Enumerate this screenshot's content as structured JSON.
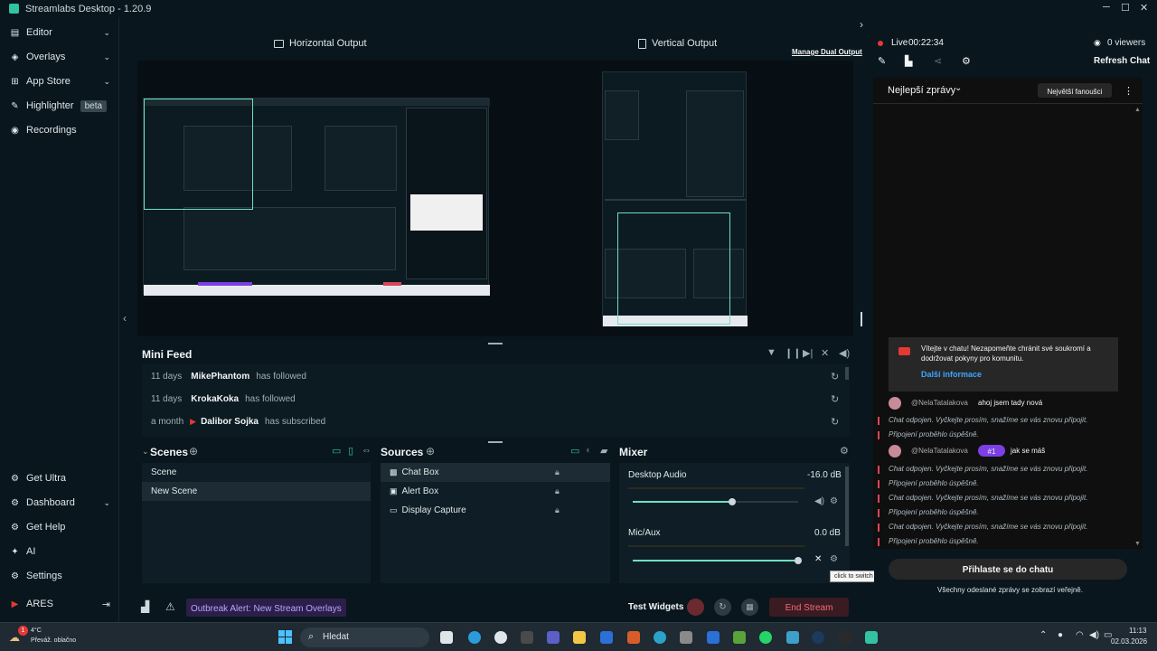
{
  "titlebar": {
    "title": "Streamlabs Desktop - 1.20.9"
  },
  "sidebar": {
    "items": [
      {
        "label": "Editor",
        "icon": "editor-icon"
      },
      {
        "label": "Overlays",
        "icon": "overlays-icon"
      },
      {
        "label": "App Store",
        "icon": "store-icon"
      },
      {
        "label": "Highlighter",
        "icon": "highlighter-icon",
        "badge": "beta"
      },
      {
        "label": "Recordings",
        "icon": "recordings-icon"
      }
    ],
    "bottom": [
      {
        "label": "Get Ultra",
        "icon": "ultra-icon"
      },
      {
        "label": "Dashboard",
        "icon": "dashboard-icon"
      },
      {
        "label": "Get Help",
        "icon": "help-icon"
      },
      {
        "label": "AI",
        "icon": "ai-icon"
      },
      {
        "label": "Settings",
        "icon": "settings-icon"
      },
      {
        "label": "ARES",
        "icon": "youtube-icon"
      }
    ]
  },
  "outputs": {
    "horizontal": "Horizontal Output",
    "vertical": "Vertical Output",
    "manage": "Manage Dual Output"
  },
  "minifeed": {
    "title": "Mini Feed",
    "rows": [
      {
        "time": "11 days",
        "name": "MikePhantom",
        "action": "has followed"
      },
      {
        "time": "11 days",
        "name": "KrokaKoka",
        "action": "has followed"
      },
      {
        "time": "a month",
        "name": "Dalibor Sojka",
        "action": "has subscribed"
      }
    ]
  },
  "scenes": {
    "title": "Scenes",
    "items": [
      "Scene",
      "New Scene"
    ],
    "selected": 1
  },
  "sources": {
    "title": "Sources",
    "items": [
      "Chat Box",
      "Alert Box",
      "Display Capture"
    ],
    "selected": 0
  },
  "mixer": {
    "title": "Mixer",
    "channels": [
      {
        "name": "Desktop Audio",
        "db": "-16.0 dB",
        "level": 0.6
      },
      {
        "name": "Mic/Aux",
        "db": "0.0 dB",
        "level": 1.0
      }
    ],
    "tooltip": "click to switch on"
  },
  "footer": {
    "alert": "Outbreak Alert: New Stream Overlays",
    "test_widgets": "Test Widgets",
    "end_stream": "End Stream"
  },
  "chat": {
    "live": "Live",
    "time": "00:22:34",
    "viewers": "0 viewers",
    "refresh": "Refresh Chat",
    "top_messages": "Nejlepší zprávy",
    "top_fans": "Největší fanoušci",
    "welcome": "Vítejte v chatu! Nezapomeňte chránit své soukromí a dodržovat pokyny pro komunitu.",
    "more_info": "Další informace",
    "user": "@NelaTatalakova",
    "msg1": "ahoj jsem tady nová",
    "msg2": "jak se máš",
    "rank": "#1",
    "disconnected": "Chat odpojen. Vyčkejte prosím, snažíme se vás znovu připojit.",
    "reconnected": "Připojení proběhlo úspěšně.",
    "login": "Přihlaste se do chatu",
    "public_note": "Všechny odeslané zprávy se zobrazí veřejně."
  },
  "taskbar": {
    "weather_temp": "4°C",
    "weather_desc": "Převáž. oblačno",
    "search": "Hledat",
    "time": "11:13",
    "date": "02.03.2026",
    "notif": "1"
  },
  "colors": {
    "accent": "#31c3a2",
    "live": "#e53935",
    "danger": "#d7465b",
    "purple": "#7b3fe4"
  }
}
